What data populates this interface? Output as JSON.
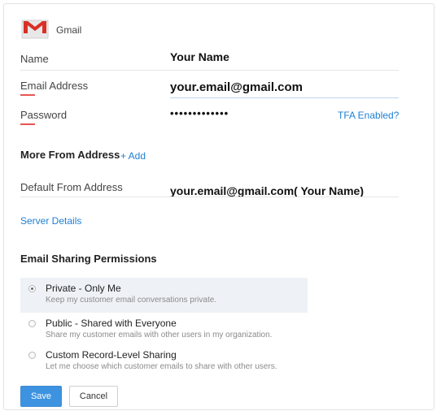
{
  "header": {
    "app_name": "Gmail",
    "logo_icon": "gmail-logo-icon"
  },
  "form": {
    "name": {
      "label": "Name",
      "value": "Your Name"
    },
    "email": {
      "label": "Email Address",
      "value": "your.email@gmail.com"
    },
    "password": {
      "label": "Password",
      "value": "•••••••••••••",
      "tfa_link": "TFA Enabled?"
    }
  },
  "more_from": {
    "title": "More From Address",
    "add_link": "+ Add",
    "default_label": "Default From Address",
    "default_value": "your.email@gmail.com( Your Name)"
  },
  "server_details_link": "Server Details",
  "sharing": {
    "title": "Email Sharing Permissions",
    "options": [
      {
        "title": "Private - Only Me",
        "desc": "Keep my customer email conversations private.",
        "selected": true
      },
      {
        "title": "Public - Shared with Everyone",
        "desc": "Share my customer emails with other users in my organization.",
        "selected": false
      },
      {
        "title": "Custom Record-Level Sharing",
        "desc": "Let me choose which customer emails to share with other users.",
        "selected": false
      }
    ]
  },
  "buttons": {
    "save": "Save",
    "cancel": "Cancel"
  },
  "colors": {
    "accent": "#3d93e0",
    "link": "#1f80d4",
    "error": "#e85454",
    "selected_bg": "#eef2f7"
  }
}
